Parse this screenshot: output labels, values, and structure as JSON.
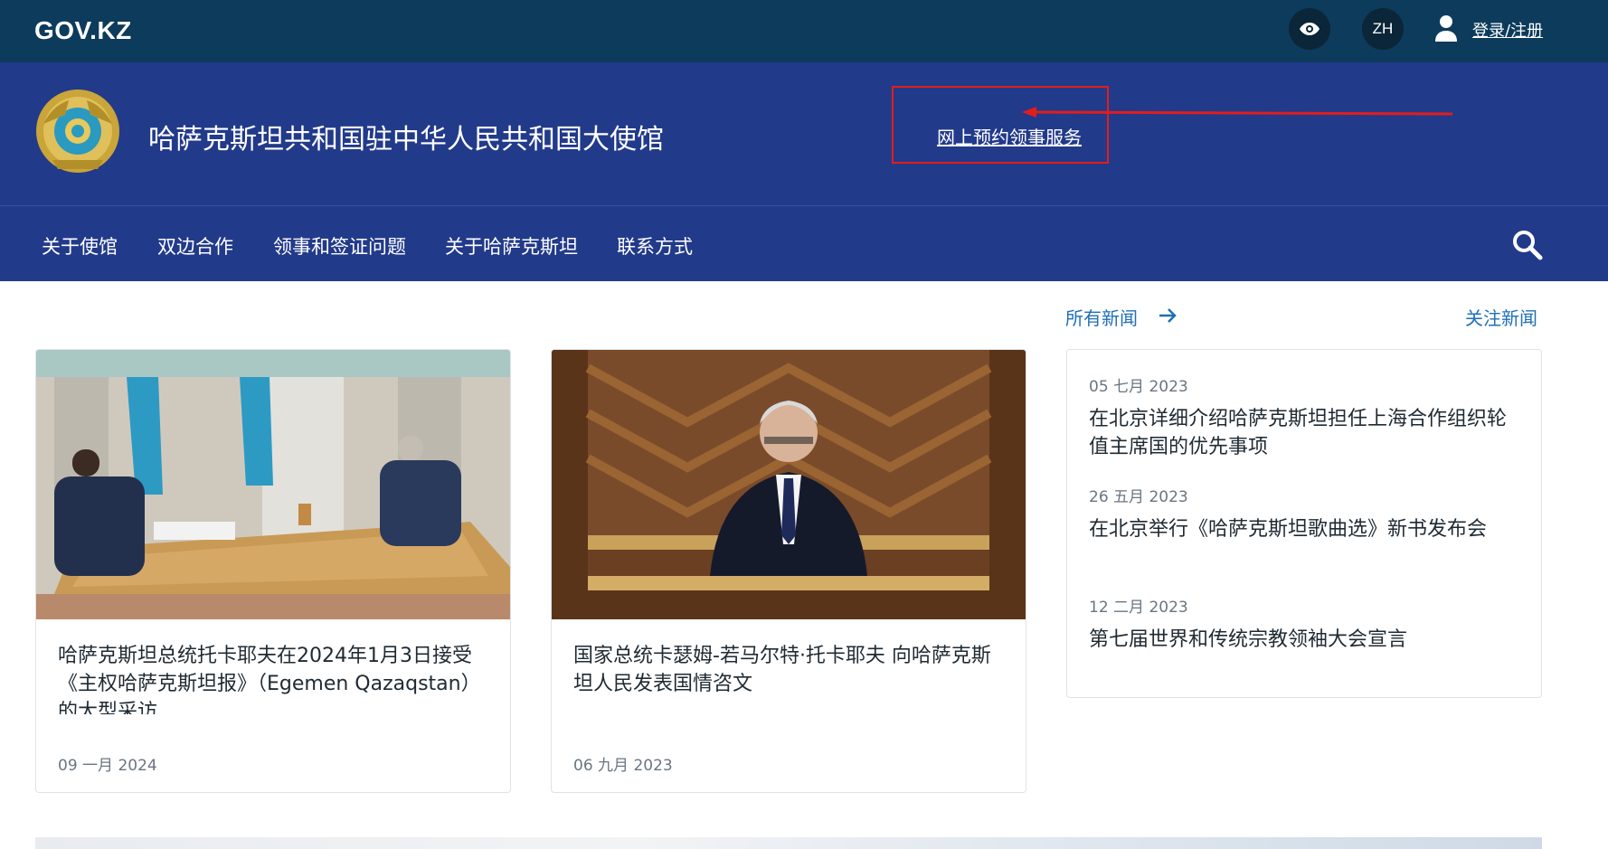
{
  "topbar": {
    "logo": "GOV.KZ",
    "eye_icon": "eye-icon",
    "lang": "ZH",
    "user_icon": "user-icon",
    "login": "登录/注册"
  },
  "header": {
    "emblem": "kazakhstan-emblem",
    "title": "哈萨克斯坦共和国驻中华人民共和国大使馆",
    "booking_link": "网上预约领事服务"
  },
  "nav": {
    "items": [
      {
        "label": "关于使馆"
      },
      {
        "label": "双边合作"
      },
      {
        "label": "领事和签证问题"
      },
      {
        "label": "关于哈萨克斯坦"
      },
      {
        "label": "联系方式"
      }
    ],
    "search_icon": "search-icon"
  },
  "news": {
    "all_news": "所有新闻",
    "follow_news": "关注新闻",
    "cards": [
      {
        "title": "哈萨克斯坦总统托卡耶夫在2024年1月3日接受《主权哈萨克斯坦报》（Egemen Qazaqstan）的大型采访",
        "date": "09 一月 2024"
      },
      {
        "title": "国家总统卡瑟姆-若马尔特·托卡耶夫 向哈萨克斯坦人民发表国情咨文",
        "date": "06 九月 2023"
      }
    ],
    "list": [
      {
        "date": "05 七月 2023",
        "title": "在北京详细介绍哈萨克斯坦担任上海合作组织轮值主席国的优先事项"
      },
      {
        "date": "26 五月 2023",
        "title": "在北京举行《哈萨克斯坦歌曲选》新书发布会"
      },
      {
        "date": "12 二月 2023",
        "title": "第七届世界和传统宗教领袖大会宣言"
      }
    ]
  },
  "colors": {
    "topbar": "#0d3b5b",
    "header": "#223a8a",
    "link": "#1f6fb6",
    "highlight": "#e21d1d"
  }
}
